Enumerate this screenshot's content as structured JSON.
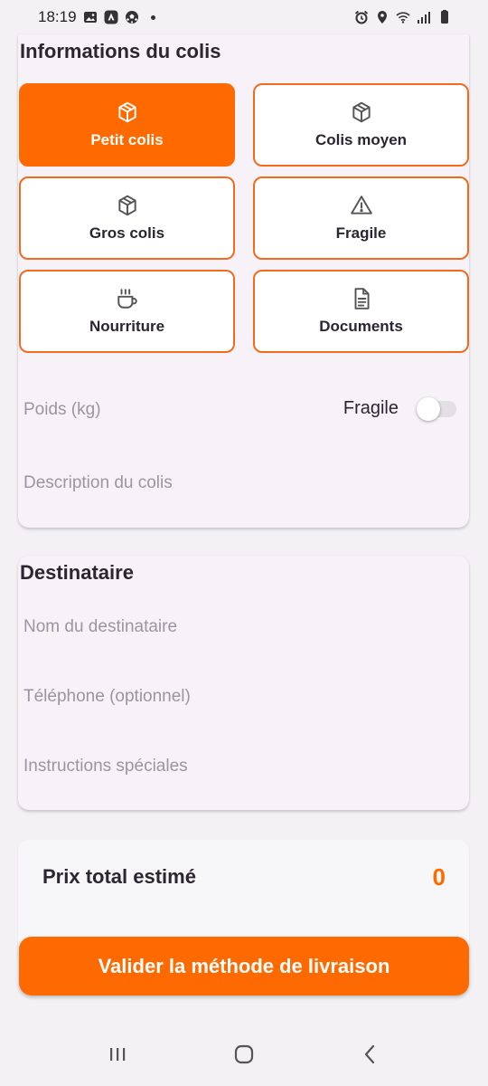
{
  "status_bar": {
    "time": "18:19",
    "left_icons": [
      "image-icon",
      "nav-app-icon",
      "soccer-ball-icon"
    ],
    "right_icons": [
      "alarm-icon",
      "location-icon",
      "wifi-icon",
      "signal-icon",
      "battery-icon"
    ]
  },
  "parcel_section": {
    "title": "Informations du colis",
    "types": [
      {
        "label": "Petit colis",
        "icon": "box-icon",
        "selected": true
      },
      {
        "label": "Colis moyen",
        "icon": "box-icon",
        "selected": false
      },
      {
        "label": "Gros colis",
        "icon": "box-icon",
        "selected": false
      },
      {
        "label": "Fragile",
        "icon": "warning-icon",
        "selected": false
      },
      {
        "label": "Nourriture",
        "icon": "coffee-cup-icon",
        "selected": false
      },
      {
        "label": "Documents",
        "icon": "document-icon",
        "selected": false
      }
    ],
    "weight_placeholder": "Poids (kg)",
    "fragile_toggle_label": "Fragile",
    "fragile_toggle_on": false,
    "description_placeholder": "Description du colis"
  },
  "recipient_section": {
    "title": "Destinataire",
    "name_placeholder": "Nom du destinataire",
    "phone_placeholder": "Téléphone (optionnel)",
    "instructions_placeholder": "Instructions spéciales"
  },
  "price": {
    "label": "Prix total estimé",
    "value": "0"
  },
  "submit_label": "Valider la méthode de livraison",
  "colors": {
    "accent": "#ff6a00",
    "card_bg": "#f6f2f8",
    "placeholder": "#9a96a0"
  },
  "nav_bar": [
    "recent-apps-icon",
    "home-icon",
    "back-icon"
  ]
}
